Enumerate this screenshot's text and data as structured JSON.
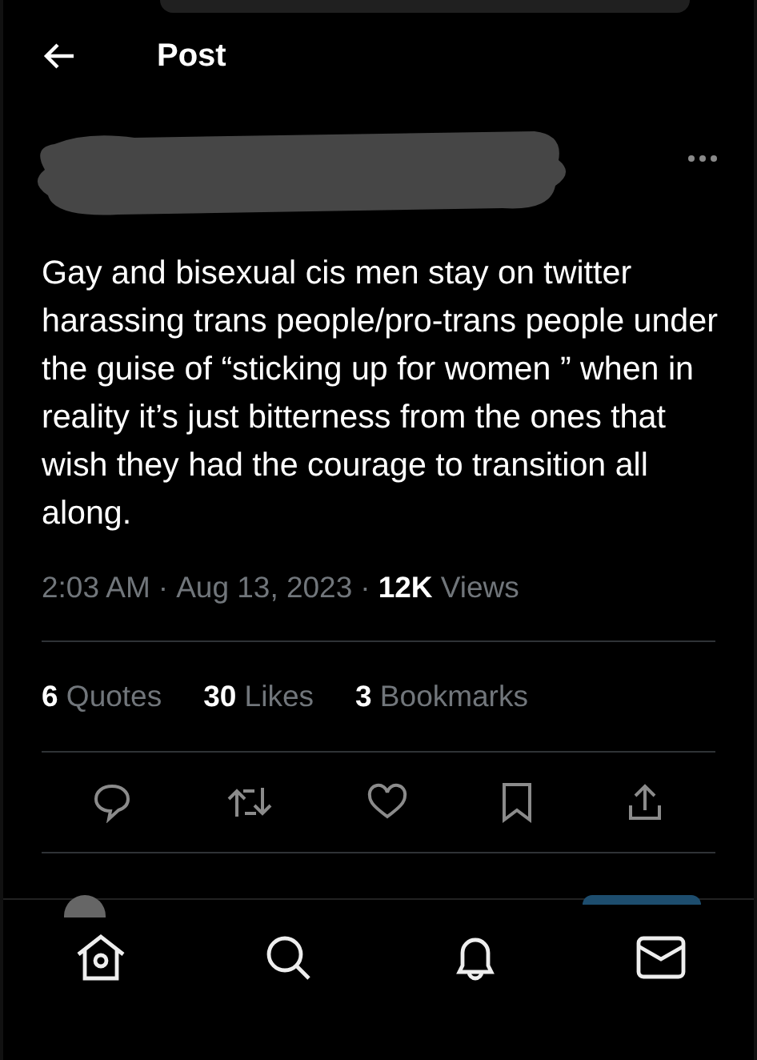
{
  "header": {
    "title": "Post"
  },
  "post": {
    "text": "Gay and bisexual cis men stay on twitter harassing trans people/pro-trans people under the guise of “sticking up for women ” when in reality it’s just bitterness from the ones that wish they had the courage to transition all along.",
    "time": "2:03 AM",
    "separator": "·",
    "date": "Aug 13, 2023",
    "views_count": "12K",
    "views_label": "Views"
  },
  "stats": [
    {
      "count": "6",
      "label": "Quotes"
    },
    {
      "count": "30",
      "label": "Likes"
    },
    {
      "count": "3",
      "label": "Bookmarks"
    }
  ]
}
